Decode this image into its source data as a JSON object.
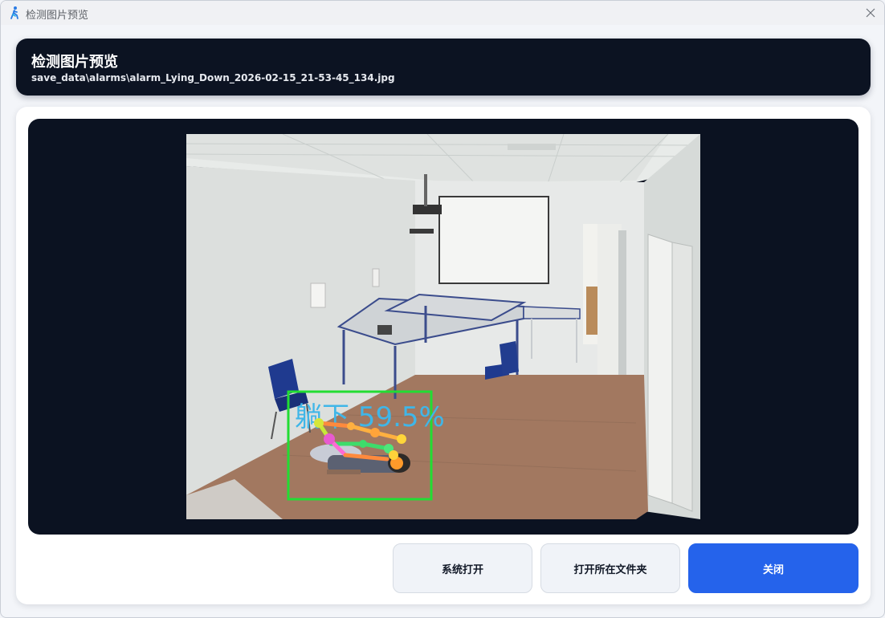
{
  "window": {
    "title": "检测图片预览",
    "app_icon": "running-figure-icon",
    "close_icon": "close-icon"
  },
  "header": {
    "title": "检测图片预览",
    "path": "save_data\\alarms\\alarm_Lying_Down_2026-02-15_21-53-45_134.jpg"
  },
  "preview": {
    "detection_label": "躺下 59.5%",
    "box_color": "#22dd33",
    "label_color": "#3fb6e8"
  },
  "buttons": {
    "system_open": "系统打开",
    "open_folder": "打开所在文件夹",
    "close": "关闭"
  },
  "colors": {
    "header_bg": "#0c1322",
    "preview_bg": "#0b1221",
    "primary": "#2563eb"
  }
}
